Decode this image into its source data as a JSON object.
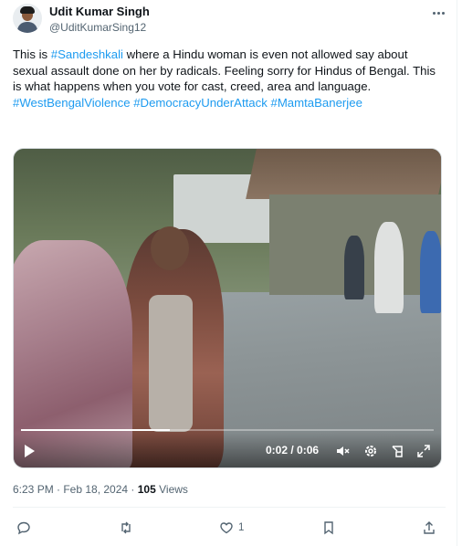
{
  "tweet": {
    "display_name": "Udit Kumar Singh",
    "handle": "@UditKumarSing12",
    "text_parts": {
      "before_tag": "This is ",
      "tag1": "#Sandeshkali",
      "after_tag": " where a Hindu woman is even not allowed say about sexual assault done on her by radicals. Feeling sorry for Hindus of Bengal. This is what happens when you vote for cast, creed, area and language.",
      "tag2": "#WestBengalViolence",
      "tag3": "#DemocracyUnderAttack",
      "tag4": "#MamtaBanerjee"
    },
    "timestamp": "6:23 PM · Feb 18, 2024 · ",
    "views_count": "105",
    "views_label": " Views"
  },
  "video": {
    "time_display": "0:02 / 0:06",
    "progress_fraction": 0.36
  },
  "actions": {
    "reply_count": "",
    "repost_count": "",
    "like_count": "1",
    "bookmark_count": ""
  },
  "icons": [
    "more-icon",
    "play-icon",
    "volume-muted-icon",
    "settings-icon",
    "picture-in-picture-icon",
    "fullscreen-icon",
    "reply-icon",
    "repost-icon",
    "like-icon",
    "bookmark-icon",
    "share-icon"
  ],
  "colors": {
    "link": "#1d9bf0",
    "text": "#0f1419",
    "secondary": "#536471"
  }
}
